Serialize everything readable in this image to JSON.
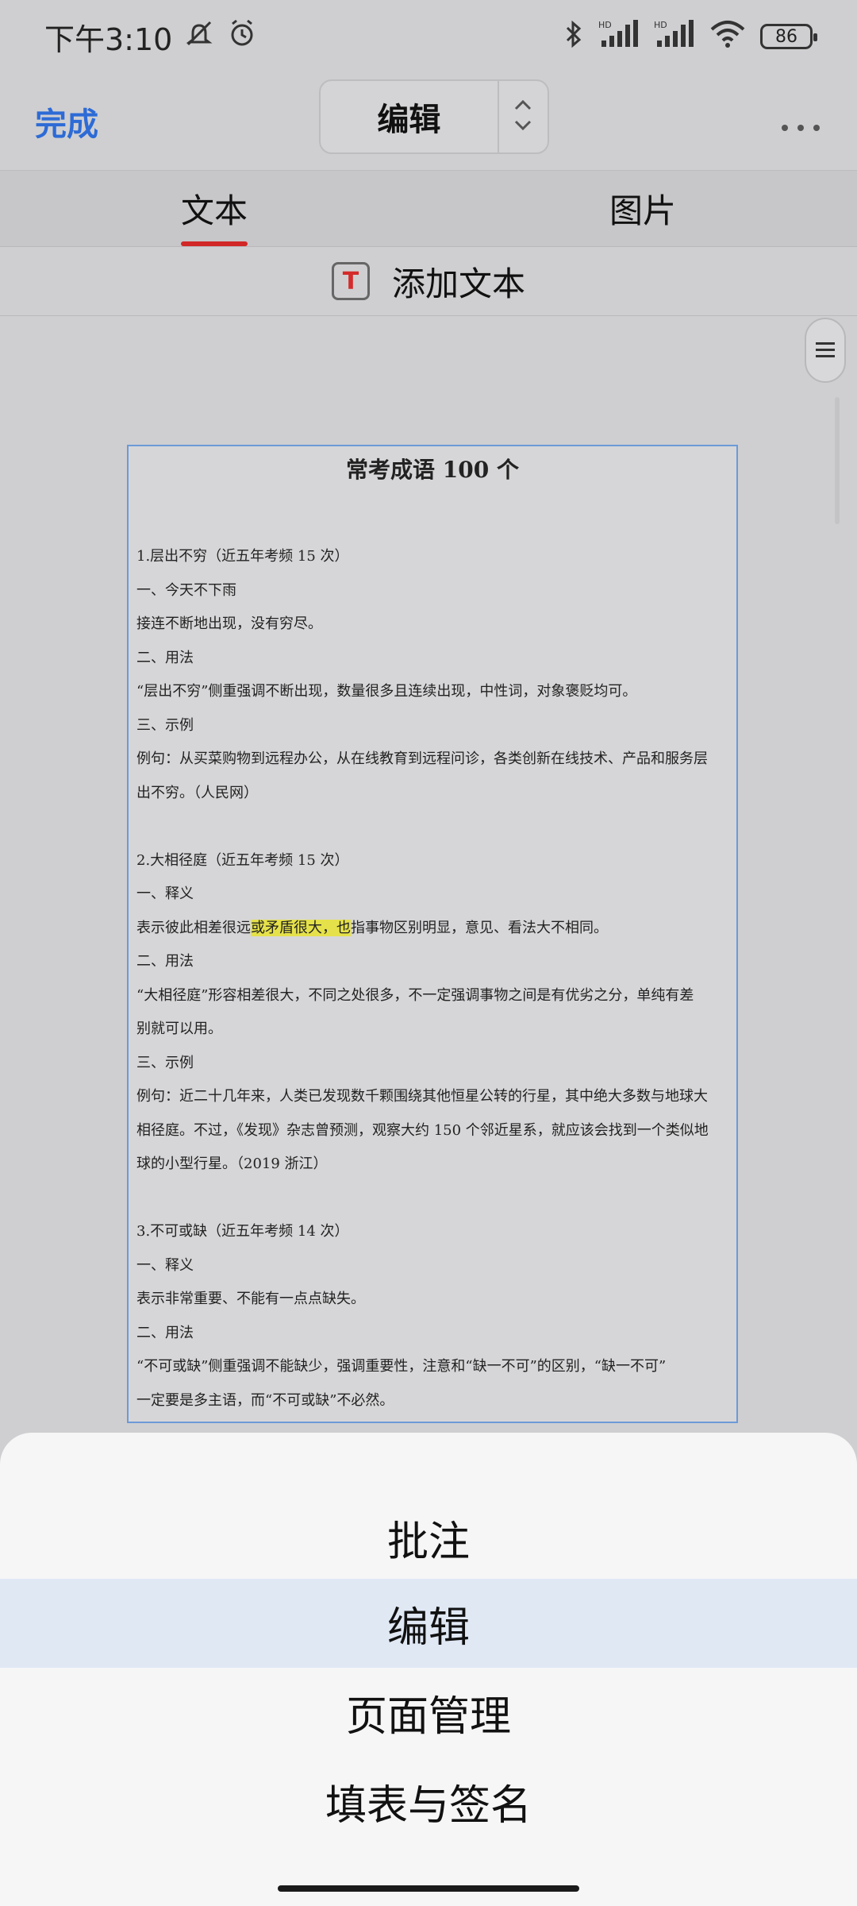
{
  "status_bar": {
    "time": "下午3:10",
    "icons": [
      "mute-icon",
      "alarm-icon",
      "bluetooth-icon",
      "signal-hd-icon",
      "signal-hd-icon",
      "wifi-icon"
    ],
    "battery": "86"
  },
  "toolbar": {
    "done_label": "完成",
    "mode_label": "编辑",
    "more_label": "···"
  },
  "tabs": [
    {
      "label": "文本",
      "active": true
    },
    {
      "label": "图片",
      "active": false
    }
  ],
  "add_text": {
    "icon_glyph": "T",
    "label": "添加文本"
  },
  "document": {
    "title": "常考成语 100 个",
    "lines": [
      "1.层出不穷（近五年考频 15 次）",
      "一、今天不下雨",
      "接连不断地出现，没有穷尽。",
      "二、用法",
      "“层出不穷”侧重强调不断出现，数量很多且连续出现，中性词，对象褒贬均可。",
      "三、示例",
      "例句：从买菜购物到远程办公，从在线教育到远程问诊，各类创新在线技术、产品和服务层",
      "出不穷。（人民网）",
      "",
      "2.大相径庭（近五年考频 15 次）",
      "一、释义",
      "表示彼此相差很远或矛盾很大，也指事物区别明显，意见、看法大不相同。",
      "二、用法",
      "“大相径庭”形容相差很大，不同之处很多，不一定强调事物之间是有优劣之分，单纯有差",
      "别就可以用。",
      "三、示例",
      "例句：近二十几年来，人类已发现数千颗围绕其他恒星公转的行星，其中绝大多数与地球大",
      "相径庭。不过，《发现》杂志曾预测，观察大约 150 个邻近星系，就应该会找到一个类似地",
      "球的小型行星。（2019 浙江）",
      "",
      "3.不可或缺（近五年考频 14 次）",
      "一、释义",
      "表示非常重要、不能有一点点缺失。",
      "二、用法",
      "“不可或缺”侧重强调不能缺少，强调重要性，注意和“缺一不可”的区别，“缺一不可”",
      "一定要是多主语，而“不可或缺”不必然。"
    ]
  },
  "sheet": {
    "items": [
      {
        "label": "批注",
        "selected": false
      },
      {
        "label": "编辑",
        "selected": true
      },
      {
        "label": "页面管理",
        "selected": false
      },
      {
        "label": "填表与签名",
        "selected": false
      }
    ]
  }
}
